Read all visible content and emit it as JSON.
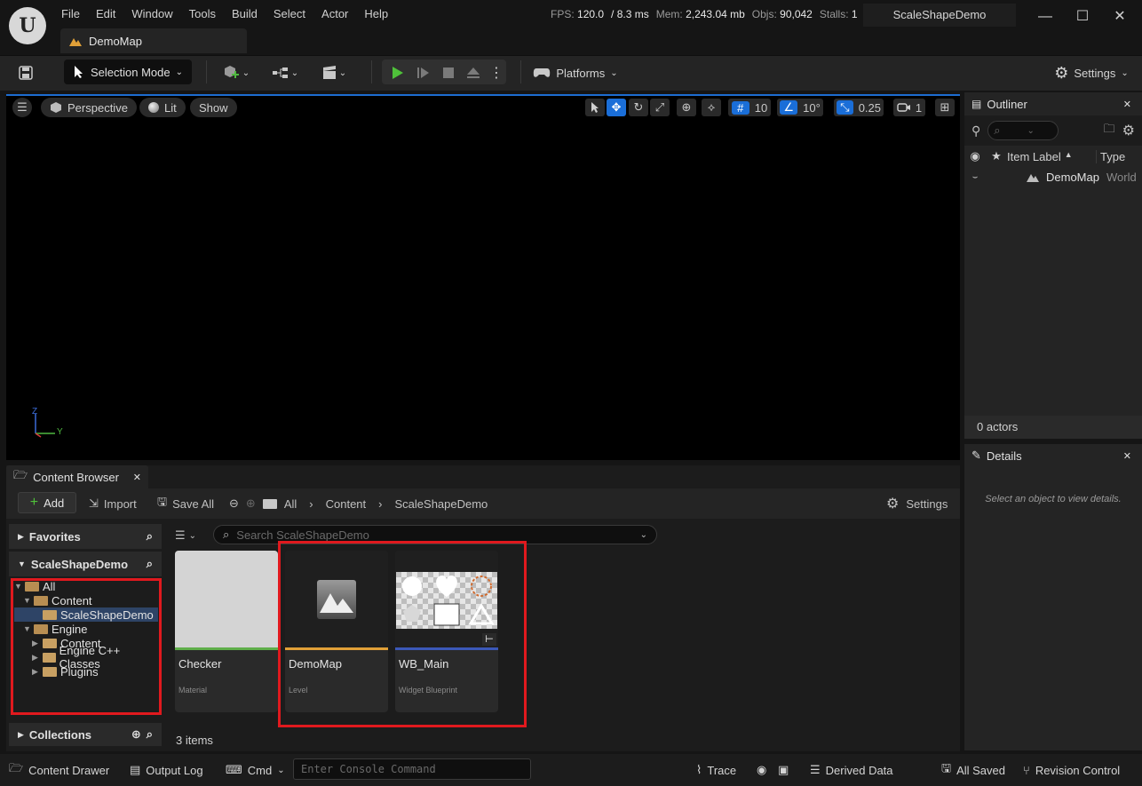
{
  "title_bar": {
    "logo_letter": "U",
    "menu": [
      "File",
      "Edit",
      "Window",
      "Tools",
      "Build",
      "Select",
      "Actor",
      "Help"
    ],
    "stats": {
      "fps_label": "FPS:",
      "fps_value": "120.0",
      "ms_value": "/ 8.3 ms",
      "mem_label": "Mem:",
      "mem_value": "2,243.04 mb",
      "objs_label": "Objs:",
      "objs_value": "90,042",
      "stalls_label": "Stalls:",
      "stalls_value": "1"
    },
    "project_name": "ScaleShapeDemo",
    "window_buttons": {
      "minimize": "—",
      "maximize": "☐",
      "close": "✕"
    }
  },
  "document_tab": {
    "label": "DemoMap",
    "icon": "level-icon"
  },
  "toolbar": {
    "selection_mode": "Selection Mode",
    "platforms": "Platforms",
    "settings": "Settings"
  },
  "viewport": {
    "perspective": "Perspective",
    "lit": "Lit",
    "show": "Show",
    "grid_snap": "10",
    "rotation_snap": "10°",
    "scale_snap": "0.25",
    "camera_speed": "1",
    "axis_z": "Z",
    "axis_y": "Y"
  },
  "outliner": {
    "title": "Outliner",
    "col_label": "Item Label",
    "col_type": "Type",
    "sort_indicator": "▲",
    "rows": [
      {
        "label": "DemoMap",
        "type": "World"
      }
    ],
    "footer": "0 actors"
  },
  "details": {
    "title": "Details",
    "empty_message": "Select an object to view details."
  },
  "content_browser": {
    "title": "Content Browser",
    "add": "Add",
    "import": "Import",
    "save_all": "Save All",
    "breadcrumb": [
      "All",
      "Content",
      "ScaleShapeDemo"
    ],
    "settings": "Settings",
    "favorites": "Favorites",
    "project_section": "ScaleShapeDemo",
    "collections": "Collections",
    "search_placeholder": "Search ScaleShapeDemo",
    "tree": [
      {
        "label": "All",
        "depth": 0,
        "expanded": true,
        "selected": false
      },
      {
        "label": "Content",
        "depth": 1,
        "expanded": true,
        "selected": false
      },
      {
        "label": "ScaleShapeDemo",
        "depth": 2,
        "expanded": false,
        "selected": true
      },
      {
        "label": "Engine",
        "depth": 1,
        "expanded": true,
        "selected": false
      },
      {
        "label": "Content",
        "depth": 2,
        "expanded": false,
        "selected": false
      },
      {
        "label": "Engine C++ Classes",
        "depth": 2,
        "expanded": false,
        "selected": false
      },
      {
        "label": "Plugins",
        "depth": 2,
        "expanded": false,
        "selected": false
      }
    ],
    "assets": [
      {
        "name": "Checker",
        "type": "Material",
        "color": "#5fae4a"
      },
      {
        "name": "DemoMap",
        "type": "Level",
        "color": "#e0a038"
      },
      {
        "name": "WB_Main",
        "type": "Widget Blueprint",
        "color": "#3b58b8"
      }
    ],
    "item_count": "3 items"
  },
  "status_bar": {
    "content_drawer": "Content Drawer",
    "output_log": "Output Log",
    "cmd": "Cmd",
    "console_placeholder": "Enter Console Command",
    "trace": "Trace",
    "derived_data": "Derived Data",
    "all_saved": "All Saved",
    "revision_control": "Revision Control"
  }
}
